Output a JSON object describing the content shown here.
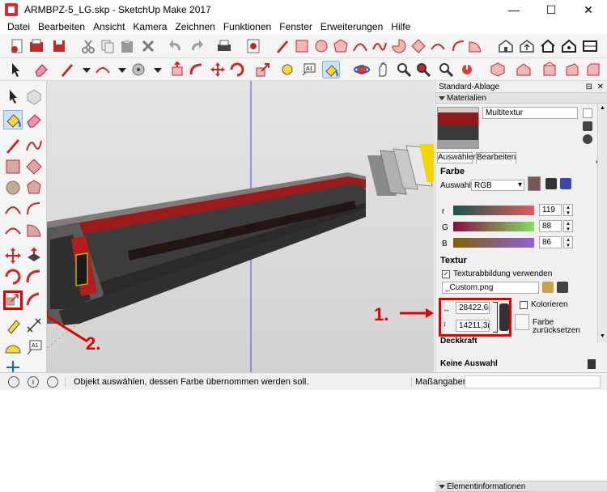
{
  "window": {
    "title": "ARMBPZ-5_LG.skp - SketchUp Make 2017",
    "minimize": "—",
    "maximize": "☐",
    "close": "✕"
  },
  "menu": [
    "Datei",
    "Bearbeiten",
    "Ansicht",
    "Kamera",
    "Zeichnen",
    "Funktionen",
    "Fenster",
    "Erweiterungen",
    "Hilfe"
  ],
  "panel": {
    "title": "Standard-Ablage",
    "materials_title": "Materialien",
    "material_name": "Multitextur",
    "tabs": [
      "Auswählen",
      "Bearbeiten"
    ],
    "color_heading": "Farbe",
    "picker_label": "Auswahl:",
    "picker_value": "RGB",
    "r_label": "r",
    "g_label": "G",
    "b_label": "B",
    "r_value": "119",
    "g_value": "88",
    "b_value": "86",
    "swatch_color": "#775856",
    "texture_heading": "Textur",
    "texture_checkbox": "Texturabbildung verwenden",
    "texture_file": "_Custom.png",
    "width_value": "28422,6m",
    "height_value": "14211,3m",
    "colorize_label": "Kolorieren",
    "reset_label": "Farbe zurücksetzen",
    "opacity_heading": "Deckkraft",
    "entity_title": "Elementinformationen",
    "entity_value": "Keine Auswahl"
  },
  "annotations": {
    "label_1": "1.",
    "label_2": "2."
  },
  "status": {
    "message": "Objekt auswählen, dessen Farbe übernommen werden soll.",
    "measure_label": "Maßangaben"
  }
}
